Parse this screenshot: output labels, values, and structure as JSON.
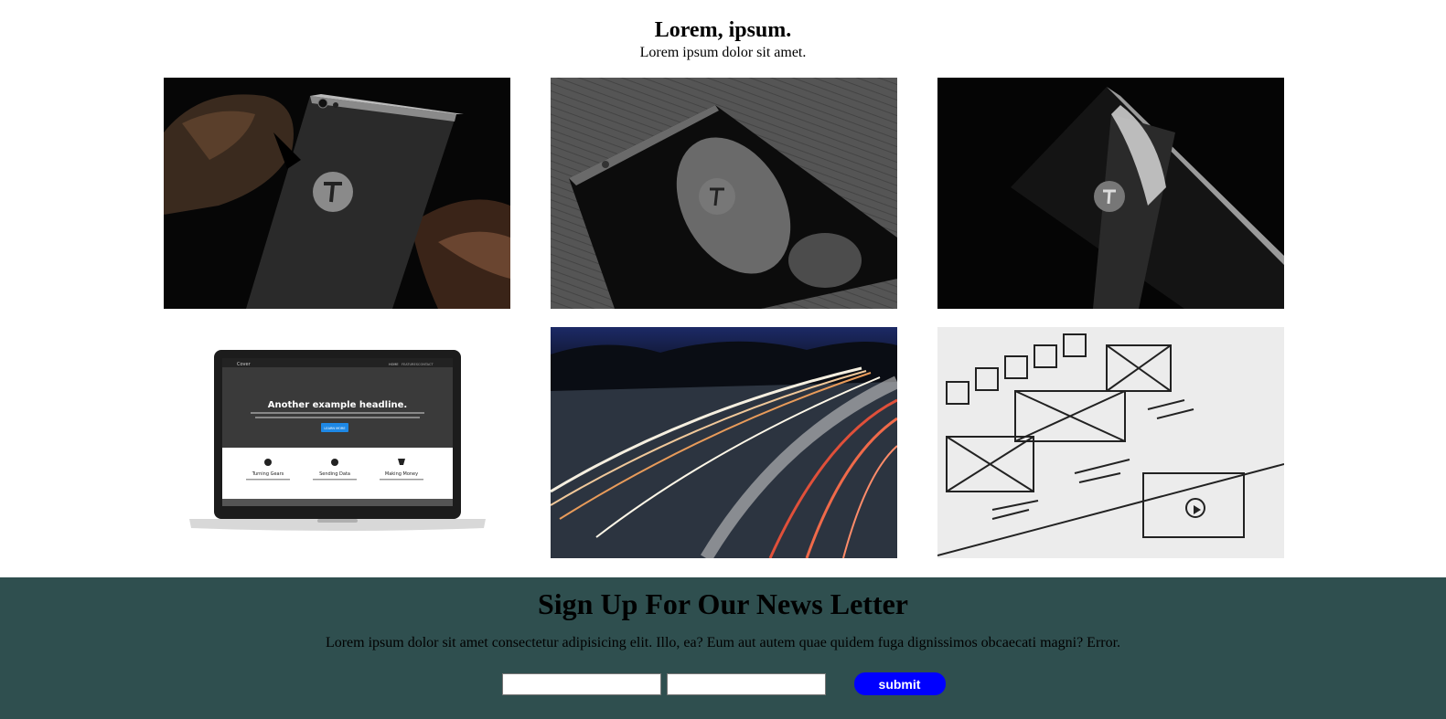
{
  "header": {
    "title": "Lorem, ipsum.",
    "subtitle": "Lorem ipsum dolor sit amet."
  },
  "gallery": {
    "laptop_screen": {
      "brand": "Cover",
      "nav": [
        "HOME",
        "FEATURES",
        "CONTACT"
      ],
      "headline": "Another example headline.",
      "cta": "LEARN MORE",
      "features": [
        "Turning Gears",
        "Sending Data",
        "Making Money"
      ]
    }
  },
  "newsletter": {
    "title": "Sign Up For Our News Letter",
    "description": "Lorem ipsum dolor sit amet consectetur adipisicing elit. Illo, ea? Eum aut autem quae quidem fuga dignissimos obcaecati magni? Error.",
    "submit_label": "submit",
    "background": "#2f4f4f",
    "button_color": "#0000ff"
  }
}
